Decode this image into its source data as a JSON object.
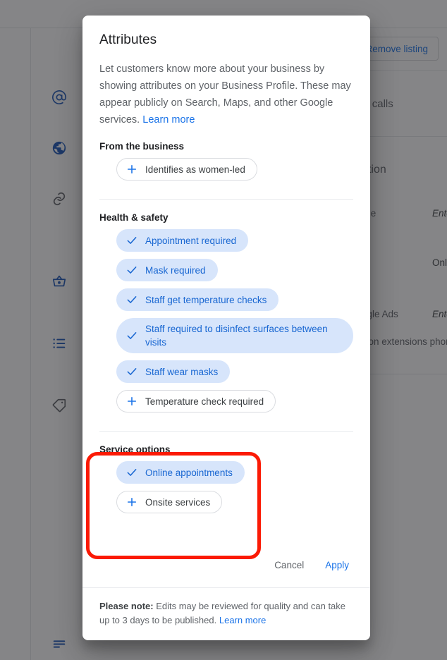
{
  "background": {
    "remove_listing_button": "Remove listing",
    "assistant_text": "Google Assistant calls",
    "advanced_section": "Advanced information",
    "store_code_label": "Store code",
    "store_code_value": "Enter store code",
    "labels_value": "Online appointments",
    "ads_label": "Google Ads",
    "ads_value": "Enter location extensions phone",
    "ads_sub_label": "location extensions phone",
    "sidebar_icons": [
      "at-sign-icon",
      "globe-icon",
      "link-icon",
      "shopping-basket-icon",
      "list-icon",
      "tag-icon",
      "short-text-icon"
    ]
  },
  "dialog": {
    "title": "Attributes",
    "description": "Let customers know more about your business by showing attributes on your Business Profile. These may appear publicly on Search, Maps, and other Google services.",
    "description_link": "Learn more",
    "sections": [
      {
        "title": "From the business",
        "chips": [
          {
            "label": "Identifies as women-led",
            "selected": false,
            "icon": "plus-icon"
          }
        ]
      },
      {
        "title": "Health & safety",
        "chips": [
          {
            "label": "Appointment required",
            "selected": true,
            "icon": "check-icon"
          },
          {
            "label": "Mask required",
            "selected": true,
            "icon": "check-icon"
          },
          {
            "label": "Staff get temperature checks",
            "selected": true,
            "icon": "check-icon"
          },
          {
            "label": "Staff required to disinfect surfaces between visits",
            "selected": true,
            "icon": "check-icon"
          },
          {
            "label": "Staff wear masks",
            "selected": true,
            "icon": "check-icon"
          },
          {
            "label": "Temperature check required",
            "selected": false,
            "icon": "plus-icon"
          }
        ]
      },
      {
        "title": "Service options",
        "highlighted": true,
        "chips": [
          {
            "label": "Online appointments",
            "selected": true,
            "icon": "check-icon"
          },
          {
            "label": "Onsite services",
            "selected": false,
            "icon": "plus-icon"
          }
        ]
      }
    ],
    "cancel_label": "Cancel",
    "apply_label": "Apply",
    "footer_prefix": "Please note:",
    "footer_text": " Edits may be reviewed for quality and can take up to 3 days to be published. ",
    "footer_link": "Learn more"
  },
  "colors": {
    "accent": "#1a73e8",
    "chip_selected_bg": "#d7e5fb",
    "chip_selected_text": "#1967d2",
    "highlight": "#fb1a05",
    "scrim": "rgba(32,33,36,0.55)"
  }
}
